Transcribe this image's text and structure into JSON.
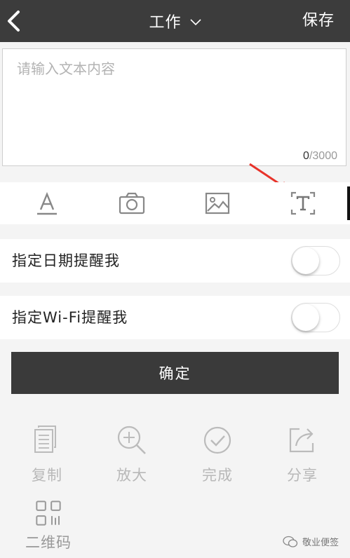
{
  "nav": {
    "title": "工作",
    "save_label": "保存"
  },
  "editor": {
    "placeholder": "请输入文本内容",
    "count_current": "0",
    "count_max": "/3000"
  },
  "toolbar": {
    "tools": [
      "font-format",
      "camera",
      "image",
      "text-recognition"
    ]
  },
  "reminders": [
    {
      "label": "指定日期提醒我",
      "enabled": false
    },
    {
      "label": "指定Wi-Fi提醒我",
      "enabled": false
    }
  ],
  "confirm_label": "确定",
  "actions": [
    {
      "label": "复制",
      "icon": "copy-icon"
    },
    {
      "label": "放大",
      "icon": "zoom-in-icon"
    },
    {
      "label": "完成",
      "icon": "check-circle-icon"
    },
    {
      "label": "分享",
      "icon": "share-icon"
    },
    {
      "label": "二维码",
      "icon": "qr-code-icon"
    }
  ],
  "watermark": "敬业便签",
  "colors": {
    "nav_bg": "#3c3c3c",
    "button_bg": "#3a3a3a",
    "arrow": "#e8332a",
    "muted": "#b8b8b8"
  }
}
